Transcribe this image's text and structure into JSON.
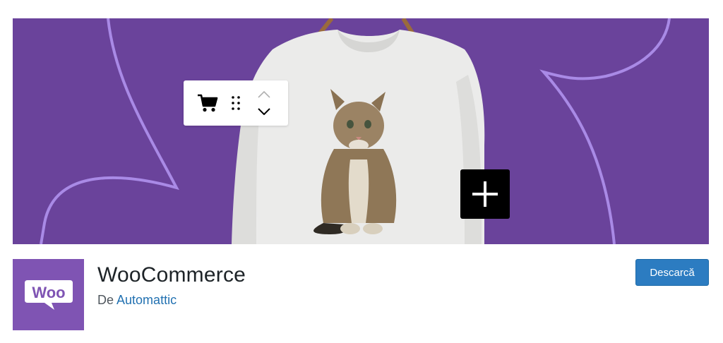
{
  "banner": {
    "background_color": "#6a439b",
    "curve_color": "#a98ae6",
    "toolbar": {
      "icons": [
        "cart-icon",
        "drag-handle-icon",
        "chevron-up-icon",
        "chevron-down-icon"
      ]
    },
    "add_block_icon": "plus-icon"
  },
  "plugin": {
    "logo_text": "Woo",
    "logo_color": "#7f54b3",
    "name": "WooCommerce",
    "by_prefix": "De",
    "author": "Automattic",
    "author_color": "#2271b1",
    "download_label": "Descarcă",
    "download_color": "#2c7cc1"
  }
}
